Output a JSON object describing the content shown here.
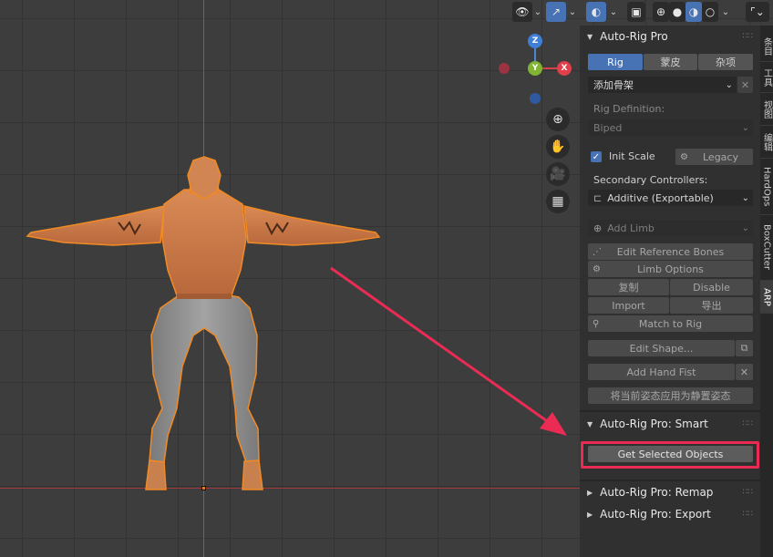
{
  "viewport": {
    "colors": {
      "background": "#3d3d3d",
      "axis_x": "#a23838",
      "axis_z": "#3f6ea8",
      "selection_outline": "#f08a24",
      "annotation": "#ea2c55"
    },
    "gizmo": {
      "z": "Z",
      "y": "Y",
      "x": "X"
    },
    "toolbar_icons": [
      "view-object-types-icon",
      "gizmo-icon",
      "overlays-icon",
      "xray-icon",
      "wireframe-shading-icon",
      "solid-shading-icon",
      "material-shading-icon",
      "rendered-shading-icon",
      "editor-type-icon"
    ],
    "nav_icons": [
      "zoom-icon",
      "pan-hand-icon",
      "camera-icon",
      "grid-icon"
    ]
  },
  "panel": {
    "header_title": "Auto-Rig Pro",
    "tabs": [
      "Rig",
      "蒙皮",
      "杂项"
    ],
    "active_tab": "Rig",
    "add_armature": "添加骨架",
    "rig_definition_label": "Rig Definition:",
    "rig_definition_value": "Biped",
    "init_scale_label": "Init Scale",
    "legacy_button": "Legacy",
    "secondary_controllers_label": "Secondary Controllers:",
    "secondary_controllers_value": "Additive (Exportable)",
    "add_limb": "Add Limb",
    "edit_reference_bones": "Edit Reference Bones",
    "limb_options": "Limb Options",
    "copy": "复制",
    "disable": "Disable",
    "import": "Import",
    "export": "导出",
    "match_to_rig": "Match to Rig",
    "edit_shape": "Edit Shape...",
    "add_hand_fist": "Add Hand Fist",
    "apply_pose_as_rest": "将当前姿态应用为静置姿态",
    "smart_title": "Auto-Rig Pro: Smart",
    "get_selected_objects": "Get Selected Objects",
    "remap_title": "Auto-Rig Pro: Remap",
    "export_title": "Auto-Rig Pro: Export"
  },
  "side_tabs": [
    "条目",
    "工具",
    "视图",
    "编辑",
    "HardOps",
    "BoxCutter",
    "ARP"
  ],
  "active_side_tab": "ARP"
}
